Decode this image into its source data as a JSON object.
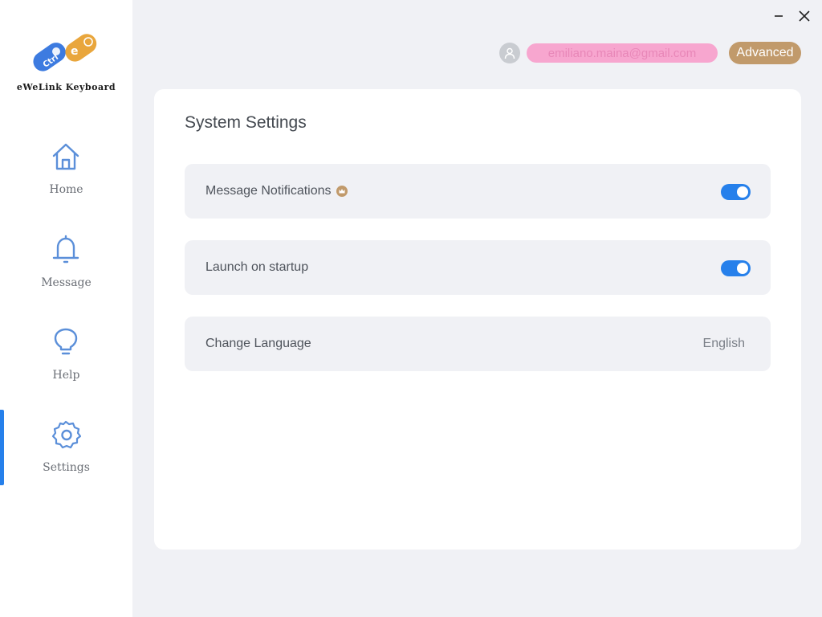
{
  "app": {
    "logo_text": "eWeLink Keyboard"
  },
  "sidebar": {
    "items": [
      {
        "label": "Home",
        "icon": "home-icon"
      },
      {
        "label": "Message",
        "icon": "bell-icon"
      },
      {
        "label": "Help",
        "icon": "lightbulb-icon"
      },
      {
        "label": "Settings",
        "icon": "gear-icon"
      }
    ],
    "active": "Settings"
  },
  "header": {
    "email": "emiliano.maina@gmail.com",
    "advanced_label": "Advanced"
  },
  "main": {
    "title": "System Settings",
    "settings": [
      {
        "label": "Message Notifications",
        "type": "toggle",
        "on": true,
        "premium": true
      },
      {
        "label": "Launch on startup",
        "type": "toggle",
        "on": true
      },
      {
        "label": "Change Language",
        "type": "value",
        "value": "English"
      }
    ]
  },
  "colors": {
    "accent": "#2680eb",
    "advanced": "#c19a6b",
    "background": "#f0f1f5"
  }
}
